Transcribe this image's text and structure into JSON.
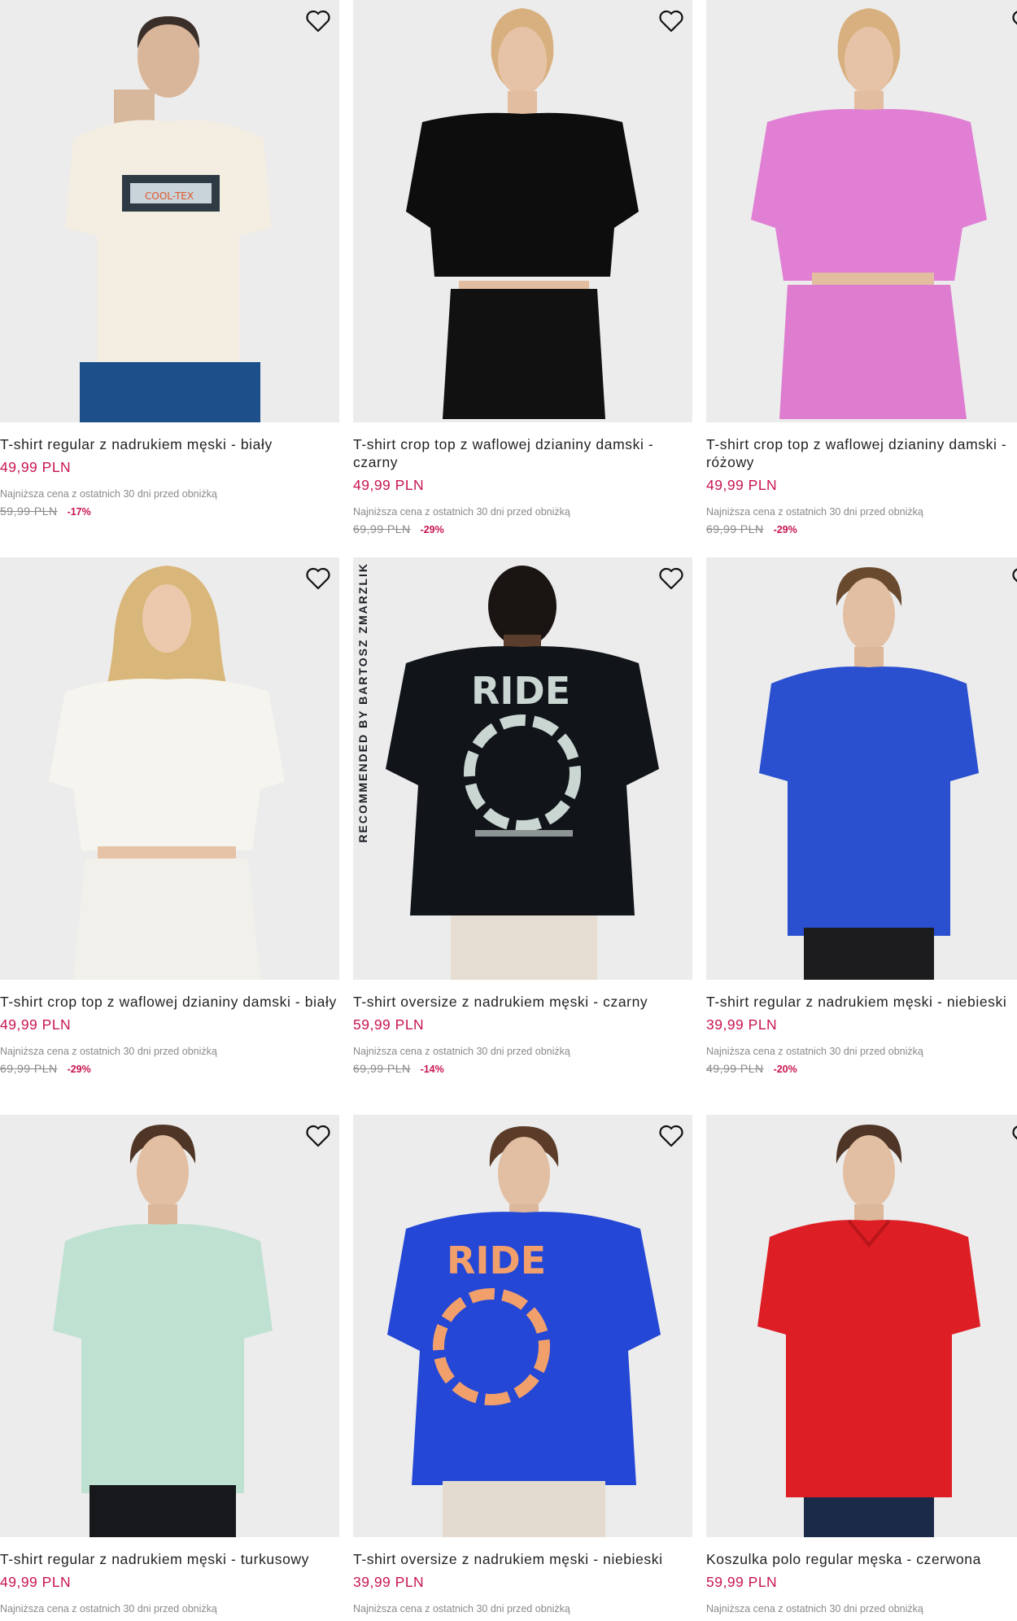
{
  "lowest_label": "Najniższa cena z ostatnich 30 dni przed obniżką",
  "badge": "RECOMMENDED BY BARTOSZ ZMARZLIK",
  "colors": {
    "price": "#c8164f",
    "old_price": "#8a8a8a",
    "image_bg": "#ececec"
  },
  "products": [
    {
      "name": "T-shirt regular z nadrukiem męski - biały",
      "price": "49,99 PLN",
      "old_price": "59,99 PLN",
      "discount": "-17%"
    },
    {
      "name": "T-shirt crop top z waflowej dzianiny damski - czarny",
      "price": "49,99 PLN",
      "old_price": "69,99 PLN",
      "discount": "-29%"
    },
    {
      "name": "T-shirt crop top z waflowej dzianiny damski - różowy",
      "price": "49,99 PLN",
      "old_price": "69,99 PLN",
      "discount": "-29%"
    },
    {
      "name": "T-shirt crop top z waflowej dzianiny damski - biały",
      "price": "49,99 PLN",
      "old_price": "69,99 PLN",
      "discount": "-29%"
    },
    {
      "name": "T-shirt oversize z nadrukiem męski - czarny",
      "price": "59,99 PLN",
      "old_price": "69,99 PLN",
      "discount": "-14%"
    },
    {
      "name": "T-shirt regular z nadrukiem męski - niebieski",
      "price": "39,99 PLN",
      "old_price": "49,99 PLN",
      "discount": "-20%"
    },
    {
      "name": "T-shirt regular z nadrukiem męski - turkusowy",
      "price": "49,99 PLN"
    },
    {
      "name": "T-shirt oversize z nadrukiem męski - niebieski",
      "price": "39,99 PLN"
    },
    {
      "name": "Koszulka polo regular męska - czerwona",
      "price": "59,99 PLN"
    }
  ]
}
